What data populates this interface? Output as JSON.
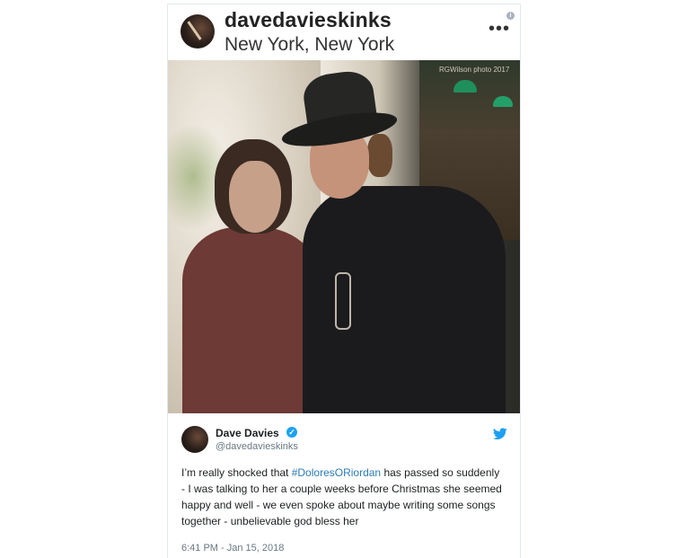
{
  "instagram": {
    "username": "davedavieskinks",
    "location": "New York, New York",
    "more_icon": "more-dots-icon",
    "info_icon": "info-icon",
    "photo_credit": "RGWilson photo 2017"
  },
  "tweet": {
    "display_name": "Dave Davies",
    "handle": "@davedavieskinks",
    "verified_icon": "verified-badge-icon",
    "brand_icon": "twitter-bird-icon",
    "text_before": "I’m really shocked that ",
    "hashtag": "#DoloresORiordan",
    "text_after": " has passed so suddenly",
    "line2": "- I was talking to her a couple weeks before Christmas she seemed happy and well - we even spoke about maybe writing some songs together - unbelievable god bless her",
    "timestamp": "6:41 PM - Jan 15, 2018"
  },
  "colors": {
    "twitter_blue": "#1da1f2",
    "hashtag_blue": "#2b7bb9",
    "muted_gray": "#697882"
  }
}
